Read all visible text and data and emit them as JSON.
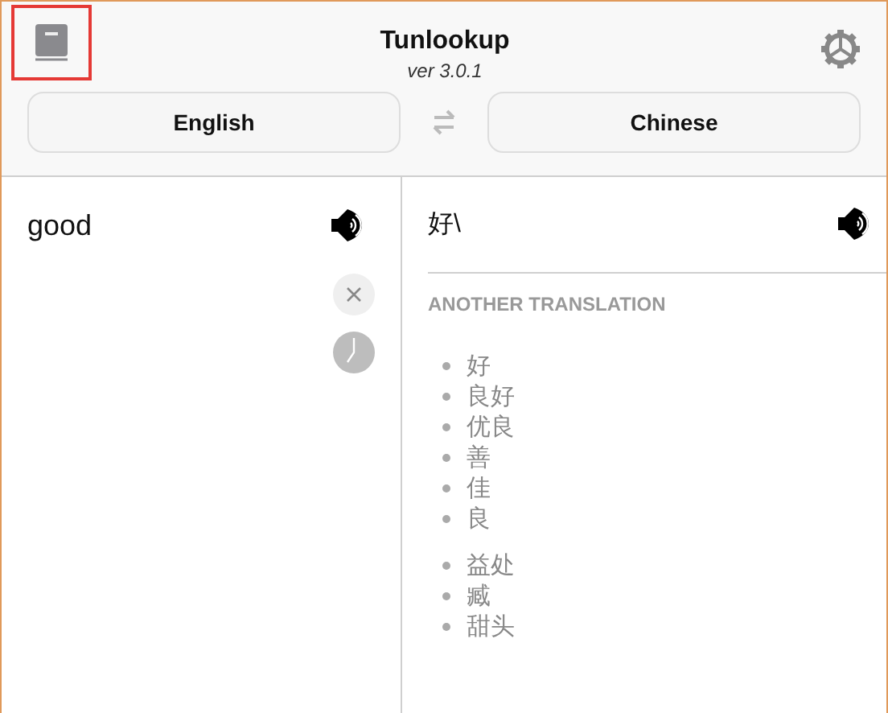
{
  "header": {
    "title": "Tunlookup",
    "version": "ver 3.0.1",
    "book_highlighted": true
  },
  "languages": {
    "source": "English",
    "target": "Chinese"
  },
  "source": {
    "text": "good"
  },
  "result": {
    "text": "好\\",
    "section_title": "ANOTHER TRANSLATION",
    "groups": [
      {
        "items": [
          "好",
          "良好",
          "优良",
          "善",
          "佳",
          "良"
        ]
      },
      {
        "items": [
          "益处",
          "臧",
          "甜头"
        ]
      }
    ]
  }
}
